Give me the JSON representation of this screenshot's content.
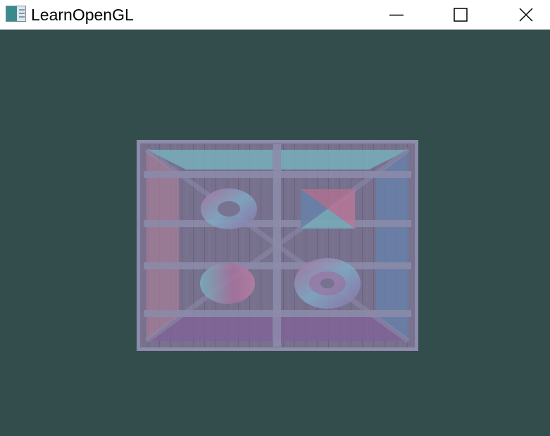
{
  "window": {
    "title": "LearnOpenGL",
    "icon": "opengl-app-icon",
    "controls": {
      "minimize_icon": "minimize-icon",
      "maximize_icon": "maximize-icon",
      "close_icon": "close-icon"
    }
  },
  "scene": {
    "clear_color": "#334d4d",
    "content": "textured-container-quad",
    "tint_colors": {
      "frame": "#8a8aa8",
      "planks": "#6f6a86",
      "top_triangle": "#6fb0b8",
      "left_band": "#a67890",
      "right_band": "#5c7ca6",
      "bottom_band": "#7a5890"
    }
  }
}
